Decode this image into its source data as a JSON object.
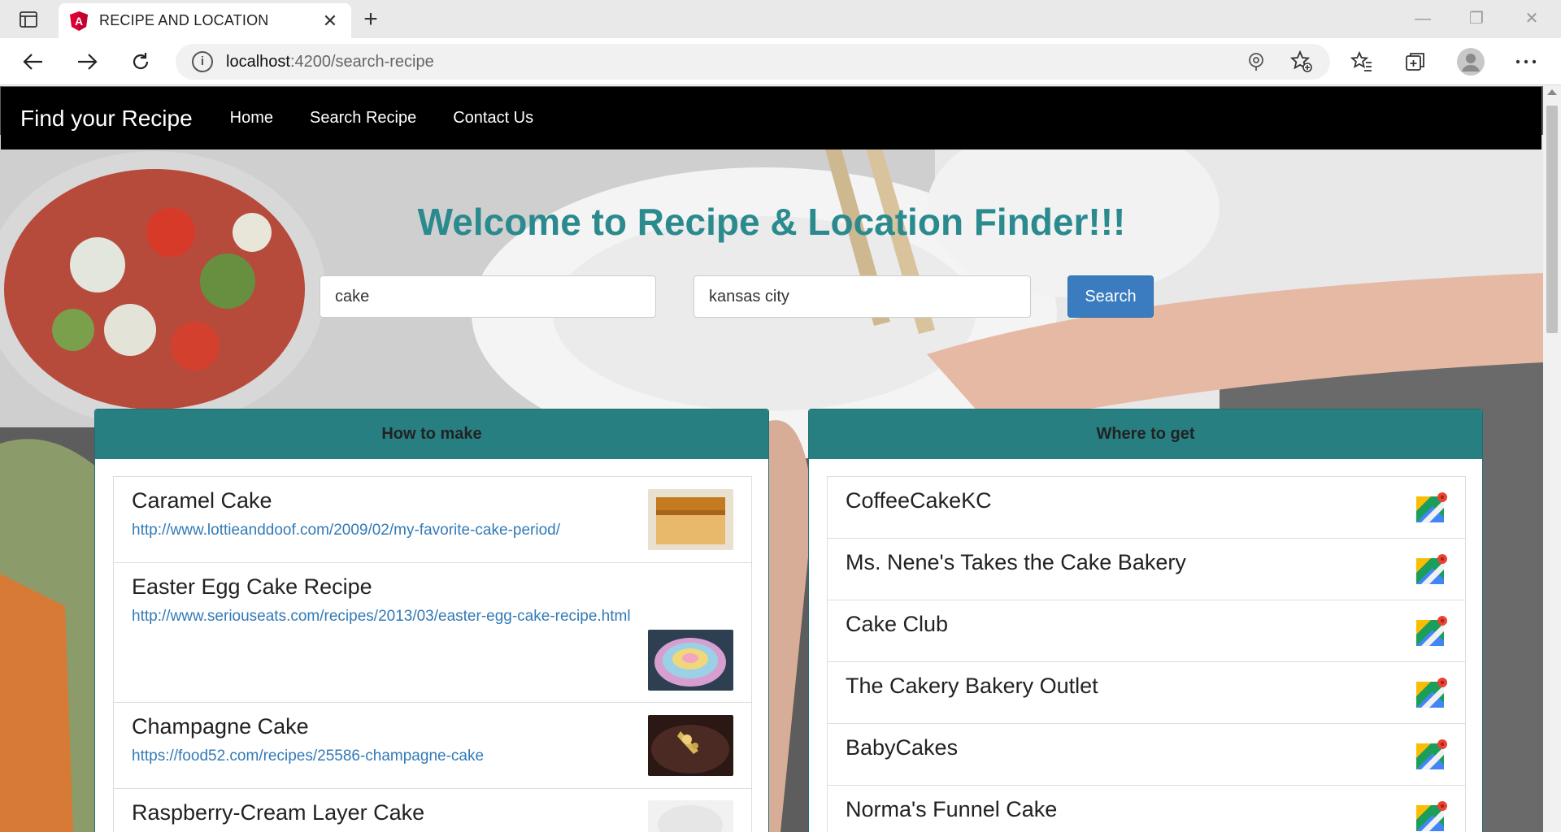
{
  "browser": {
    "tab_title": "RECIPE AND LOCATION",
    "url_host": "localhost",
    "url_path": ":4200/search-recipe"
  },
  "navbar": {
    "brand": "Find your Recipe",
    "links": [
      "Home",
      "Search Recipe",
      "Contact Us"
    ]
  },
  "hero": {
    "heading": "Welcome to Recipe & Location Finder!!!",
    "recipe_query": "cake",
    "location_query": "kansas city",
    "search_label": "Search"
  },
  "recipes_panel": {
    "title": "How to make",
    "items": [
      {
        "title": "Caramel Cake",
        "url": "http://www.lottieanddoof.com/2009/02/my-favorite-cake-period/"
      },
      {
        "title": "Easter Egg Cake Recipe",
        "url": "http://www.seriouseats.com/recipes/2013/03/easter-egg-cake-recipe.html"
      },
      {
        "title": "Champagne Cake",
        "url": "https://food52.com/recipes/25586-champagne-cake"
      },
      {
        "title": "Raspberry-Cream Layer Cake",
        "url": ""
      }
    ]
  },
  "places_panel": {
    "title": "Where to get",
    "items": [
      {
        "name": "CoffeeCakeKC"
      },
      {
        "name": "Ms. Nene's Takes the Cake Bakery"
      },
      {
        "name": "Cake Club"
      },
      {
        "name": "The Cakery Bakery Outlet"
      },
      {
        "name": "BabyCakes"
      },
      {
        "name": "Norma's Funnel Cake"
      }
    ]
  },
  "colors": {
    "accent": "#2a8a8e",
    "panel_header": "#287f82",
    "link": "#337ab7",
    "button": "#3a7cbf",
    "navbar": "#000000"
  }
}
